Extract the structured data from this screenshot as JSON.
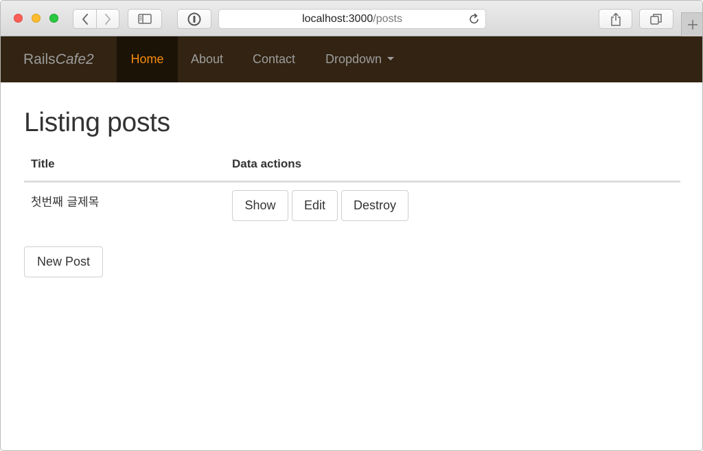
{
  "browser": {
    "url_host": "localhost:3000",
    "url_path": "/posts",
    "icons": [
      "back-icon",
      "forward-icon",
      "sidebar-icon",
      "password-icon",
      "reload-icon",
      "share-icon",
      "tabs-icon",
      "new-tab-icon"
    ]
  },
  "navbar": {
    "brand_part1": "Rails",
    "brand_part2": "Cafe2",
    "items": [
      {
        "label": "Home",
        "active": true
      },
      {
        "label": "About",
        "active": false
      },
      {
        "label": "Contact",
        "active": false
      },
      {
        "label": "Dropdown",
        "active": false
      }
    ],
    "colors": {
      "background": "#322312",
      "active_bg": "#1c1307",
      "active_text": "#f48c0a",
      "text": "#9d9d9d"
    }
  },
  "main": {
    "title": "Listing posts",
    "table": {
      "headers": [
        "Title",
        "Data actions"
      ],
      "rows": [
        {
          "title": "첫번째 글제목",
          "actions": [
            "Show",
            "Edit",
            "Destroy"
          ]
        }
      ]
    },
    "new_post_label": "New Post"
  }
}
